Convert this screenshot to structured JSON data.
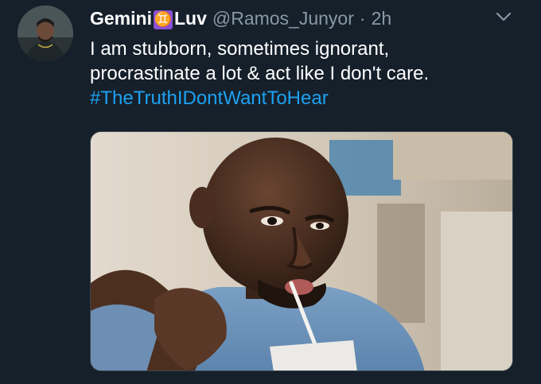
{
  "tweet": {
    "display_name_part1": "Gemini",
    "badge_symbol": "♊",
    "display_name_part2": "Luv",
    "handle": "@Ramos_Junyor",
    "separator": "·",
    "timestamp": "2h",
    "text_line1": "I am stubborn, sometimes ignorant,",
    "text_line2": "procrastinate a lot & act like I don't care.",
    "hashtag": "#TheTruthIDontWantToHear",
    "avatar_icon": "user-avatar",
    "menu_icon": "chevron-down-icon",
    "media_description_icon": "meme-photo"
  },
  "colors": {
    "background": "#15202b",
    "text": "#ffffff",
    "secondary_text": "#8899a6",
    "hashtag": "#1da1f2",
    "badge": "#8a51d4"
  }
}
